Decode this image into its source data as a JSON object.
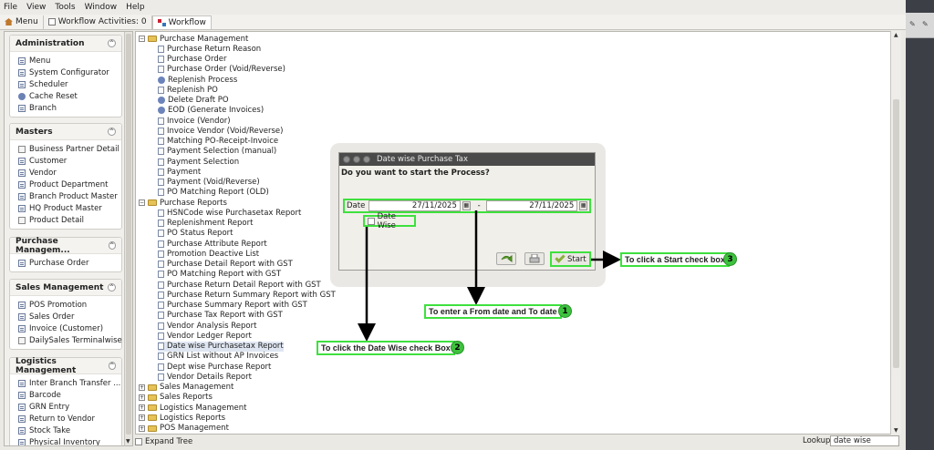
{
  "menubar": [
    "File",
    "View",
    "Tools",
    "Window",
    "Help"
  ],
  "tabs": [
    {
      "label": "Menu",
      "icon": "home-icon"
    },
    {
      "label": "Workflow Activities: 0",
      "icon": "window-icon"
    },
    {
      "label": "Workflow",
      "icon": "workflow-icon"
    }
  ],
  "sidebar": {
    "sections": [
      {
        "title": "Administration",
        "items": [
          {
            "label": "Menu",
            "icon": "doc-icon"
          },
          {
            "label": "System Configurator",
            "icon": "doc-icon"
          },
          {
            "label": "Scheduler",
            "icon": "doc-icon"
          },
          {
            "label": "Cache Reset",
            "icon": "process-icon"
          },
          {
            "label": "Branch",
            "icon": "doc-icon"
          }
        ]
      },
      {
        "title": "Masters",
        "items": [
          {
            "label": "Business Partner Detail",
            "icon": "window-icon"
          },
          {
            "label": "Customer",
            "icon": "doc-icon"
          },
          {
            "label": "Vendor",
            "icon": "doc-icon"
          },
          {
            "label": "Product Department",
            "icon": "doc-icon"
          },
          {
            "label": "Branch Product Master",
            "icon": "doc-icon"
          },
          {
            "label": "HQ Product Master",
            "icon": "doc-icon"
          },
          {
            "label": "Product Detail",
            "icon": "window-icon"
          }
        ]
      },
      {
        "title": "Purchase Managem...",
        "items": [
          {
            "label": "Purchase Order",
            "icon": "doc-icon"
          }
        ]
      },
      {
        "title": "Sales Management",
        "items": [
          {
            "label": "POS Promotion",
            "icon": "doc-icon"
          },
          {
            "label": "Sales Order",
            "icon": "doc-icon"
          },
          {
            "label": "Invoice (Customer)",
            "icon": "doc-icon"
          },
          {
            "label": "DailySales Terminalwise",
            "icon": "window-icon"
          }
        ]
      },
      {
        "title": "Logistics Management",
        "items": [
          {
            "label": "Inter Branch Transfer ...",
            "icon": "doc-icon"
          },
          {
            "label": "Barcode",
            "icon": "doc-icon"
          },
          {
            "label": "GRN Entry",
            "icon": "doc-icon"
          },
          {
            "label": "Return to Vendor",
            "icon": "doc-icon"
          },
          {
            "label": "Stock Take",
            "icon": "doc-icon"
          },
          {
            "label": "Physical Inventory",
            "icon": "doc-icon"
          }
        ]
      }
    ]
  },
  "tree": {
    "rows": [
      {
        "label": "Purchase Management",
        "type": "folder",
        "level": 0
      },
      {
        "label": "Purchase Return Reason",
        "type": "doc",
        "level": 1
      },
      {
        "label": "Purchase Order",
        "type": "doc",
        "level": 1
      },
      {
        "label": "Purchase Order (Void/Reverse)",
        "type": "doc",
        "level": 1
      },
      {
        "label": "Replenish Process",
        "type": "process",
        "level": 1
      },
      {
        "label": "Replenish PO",
        "type": "doc",
        "level": 1
      },
      {
        "label": "Delete Draft PO",
        "type": "process",
        "level": 1
      },
      {
        "label": "EOD (Generate Invoices)",
        "type": "process",
        "level": 1
      },
      {
        "label": "Invoice (Vendor)",
        "type": "doc",
        "level": 1
      },
      {
        "label": "Invoice Vendor (Void/Reverse)",
        "type": "doc",
        "level": 1
      },
      {
        "label": "Matching PO-Receipt-Invoice",
        "type": "doc",
        "level": 1
      },
      {
        "label": "Payment Selection (manual)",
        "type": "doc",
        "level": 1
      },
      {
        "label": "Payment Selection",
        "type": "doc",
        "level": 1
      },
      {
        "label": "Payment",
        "type": "doc",
        "level": 1
      },
      {
        "label": "Payment (Void/Reverse)",
        "type": "doc",
        "level": 1
      },
      {
        "label": "PO Matching Report (OLD)",
        "type": "win",
        "level": 1
      },
      {
        "label": "Purchase Reports",
        "type": "folder",
        "level": 0
      },
      {
        "label": "HSNCode wise Purchasetax Report",
        "type": "win",
        "level": 1
      },
      {
        "label": "Replenishment Report",
        "type": "win",
        "level": 1
      },
      {
        "label": "PO Status Report",
        "type": "win",
        "level": 1
      },
      {
        "label": "Purchase Attribute Report",
        "type": "win",
        "level": 1
      },
      {
        "label": "Promotion Deactive List",
        "type": "win",
        "level": 1
      },
      {
        "label": "Purchase Detail Report with GST",
        "type": "win",
        "level": 1
      },
      {
        "label": "PO Matching Report with GST",
        "type": "win",
        "level": 1
      },
      {
        "label": "Purchase Return Detail Report with GST",
        "type": "win",
        "level": 1
      },
      {
        "label": "Purchase Return Summary Report with GST",
        "type": "win",
        "level": 1
      },
      {
        "label": "Purchase Summary Report with GST",
        "type": "win",
        "level": 1
      },
      {
        "label": "Purchase Tax Report with GST",
        "type": "win",
        "level": 1
      },
      {
        "label": "Vendor Analysis Report",
        "type": "win",
        "level": 1
      },
      {
        "label": "Vendor Ledger Report",
        "type": "win",
        "level": 1
      },
      {
        "label": "Date wise Purchasetax Report",
        "type": "win",
        "level": 1,
        "selected": true
      },
      {
        "label": "GRN List without AP Invoices",
        "type": "win",
        "level": 1
      },
      {
        "label": "Dept wise Purchase Report",
        "type": "win",
        "level": 1
      },
      {
        "label": "Vendor Details Report",
        "type": "win",
        "level": 1
      },
      {
        "label": "Sales Management",
        "type": "folder",
        "level": 0,
        "collapsed": true
      },
      {
        "label": "Sales Reports",
        "type": "folder",
        "level": 0,
        "collapsed": true
      },
      {
        "label": "Logistics Management",
        "type": "folder",
        "level": 0,
        "collapsed": true
      },
      {
        "label": "Logistics Reports",
        "type": "folder",
        "level": 0,
        "collapsed": true
      },
      {
        "label": "POS Management",
        "type": "folder",
        "level": 0,
        "collapsed": true
      }
    ]
  },
  "bottom": {
    "expand_tree": "Expand Tree",
    "lookup_label": "Lookup",
    "lookup_value": "date wise"
  },
  "dialog": {
    "title": "Date wise Purchase Tax",
    "prompt": "Do you want to start the Process?",
    "date_label": "Date",
    "date_from": "27/11/2025",
    "date_separator": "-",
    "date_to": "27/11/2025",
    "date_wise_label": "Date Wise",
    "start_label": "Start"
  },
  "annotations": {
    "start_note": "To click a Start check box",
    "start_num": "3",
    "date_note": "To enter a From date and To date",
    "date_num": "1",
    "datewise_note": "To click the Date Wise check Box",
    "datewise_num": "2"
  },
  "colors": {
    "highlight": "#3ee03e",
    "badge": "#3ec23e"
  }
}
